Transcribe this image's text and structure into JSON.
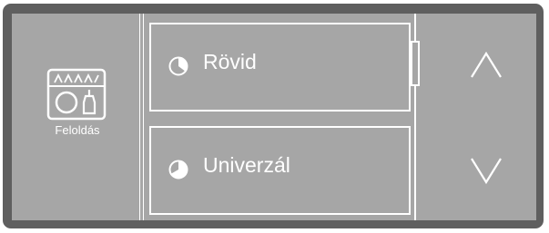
{
  "unlock": {
    "icon": "dishwasher-unlock-icon",
    "label": "Feloldás"
  },
  "programs": [
    {
      "label": "Rövid",
      "icon": "pie-clock-icon"
    },
    {
      "label": "Univerzál",
      "icon": "pie-clock-icon"
    }
  ],
  "scroll": {
    "up_icon": "chevron-up-icon",
    "down_icon": "chevron-down-icon"
  },
  "colors": {
    "bezel": "#5f5f5f",
    "screen": "#a6a6a6",
    "foreground": "#ffffff"
  }
}
